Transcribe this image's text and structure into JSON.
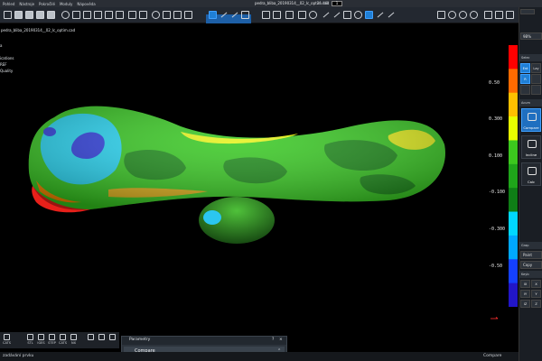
{
  "menu": [
    "Pohled",
    "Nástroje",
    "Pokročilé",
    "Moduly",
    "Nápověda"
  ],
  "title_bar": {
    "document": "pedra_bliba_20190314__02_lc_optim.cad",
    "size": "21 MB",
    "tab": "1"
  },
  "tree": {
    "root": "pedra_bliba_20190314__02_lc_optim.cad",
    "lines": [
      "a",
      "ications",
      "REF",
      "Quality"
    ]
  },
  "legend": {
    "colors": [
      "#ff0000",
      "#ff6a00",
      "#ffc000",
      "#e8ff00",
      "#3cc81e",
      "#1fa51a",
      "#0f7e16",
      "#00d8ff",
      "#00a8ff",
      "#1540ff",
      "#2216c8"
    ],
    "labels": [
      "0.50",
      "0.300",
      "0.100",
      "-0.100",
      "-0.300",
      "-0.50"
    ]
  },
  "right_panel": {
    "sections": [
      "Selec",
      "Acum",
      "Grap",
      "Keyb"
    ],
    "sel_row1": [
      "Ent",
      "Lay"
    ],
    "sel_row2": [
      "R",
      ""
    ],
    "top_label": "9B%",
    "actions": [
      "Compare",
      "Incline",
      "Calc"
    ],
    "graph_buttons": [
      "Paint",
      "Copy"
    ],
    "keyb_cells": [
      "IX",
      "X",
      "IY",
      "Y",
      "IZ",
      "Z"
    ]
  },
  "bottom_toolbar": [
    "CATS",
    "STL",
    "IGES",
    "STEP",
    "CATS",
    "NX"
  ],
  "parametry": {
    "title": "Parametry",
    "help": "?",
    "close": "×",
    "item": "Compare",
    "collapse": "⌃"
  },
  "status": {
    "left": "zadávání prvku",
    "right": "Compare"
  }
}
